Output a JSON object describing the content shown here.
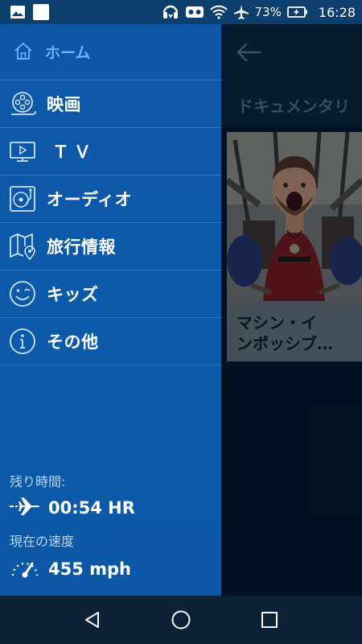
{
  "status_bar": {
    "battery": "73%",
    "time": "16:28",
    "icons": [
      "image-icon",
      "square-icon",
      "headset-icon",
      "vr-icon",
      "wifi-icon",
      "airplane-icon",
      "battery-charging-icon"
    ]
  },
  "drawer": {
    "home": {
      "label": "ホーム",
      "icon": "home-icon"
    },
    "items": [
      {
        "label": "映画",
        "icon": "film-reel-icon"
      },
      {
        "label": "ＴＶ",
        "icon": "tv-icon"
      },
      {
        "label": "オーディオ",
        "icon": "turntable-icon"
      },
      {
        "label": "旅行情報",
        "icon": "map-pin-icon"
      },
      {
        "label": "キッズ",
        "icon": "smiley-icon"
      },
      {
        "label": "その他",
        "icon": "info-icon"
      }
    ],
    "flight": {
      "remaining_label": "残り時間:",
      "remaining_value": "00:54 HR",
      "speed_label": "現在の速度",
      "speed_value": "455 mph"
    }
  },
  "content": {
    "category": "ドキュメンタリ",
    "card_title_line1": "マシン・イ",
    "card_title_line2": "ンポッシブ…"
  },
  "colors": {
    "drawer": "#0d57a8",
    "accent": "#6bb6ff",
    "content_bg": "#05182a"
  }
}
